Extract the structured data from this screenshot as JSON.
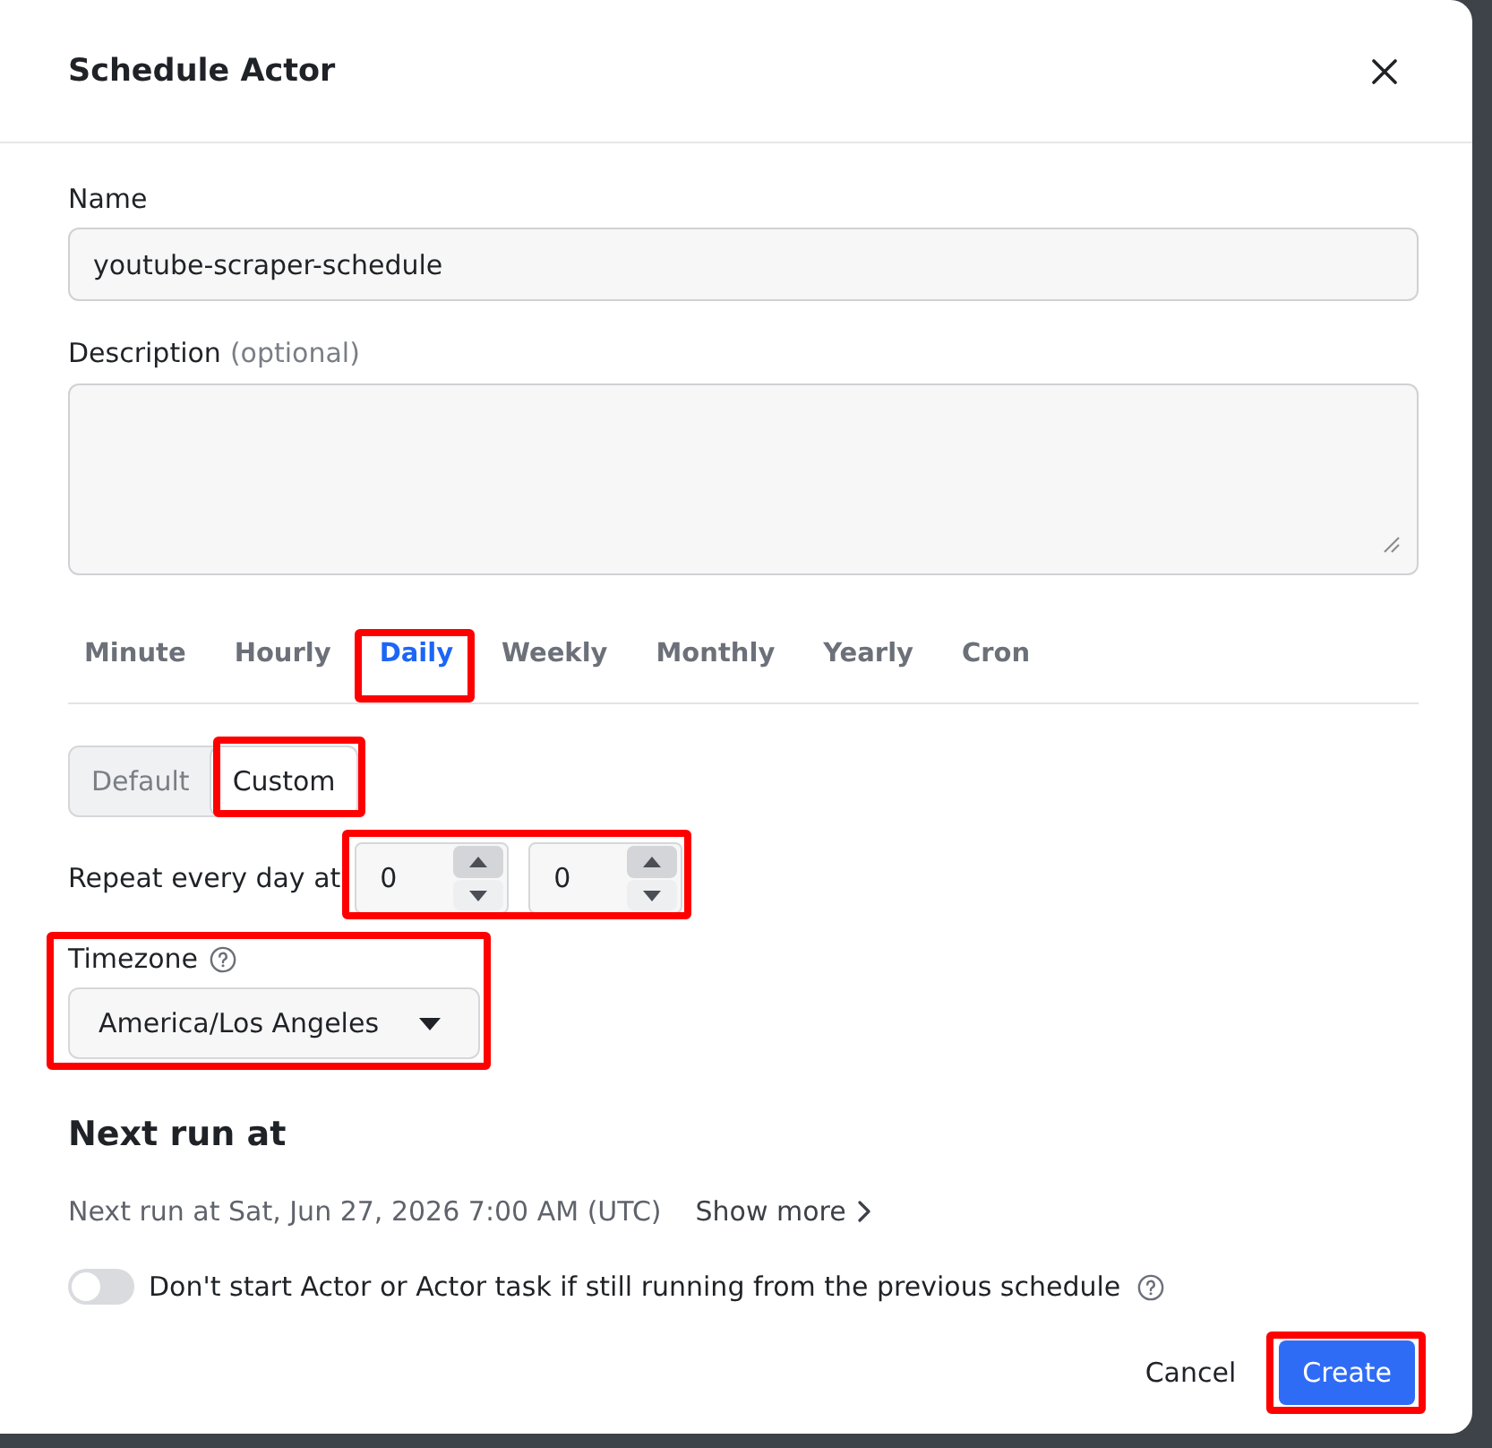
{
  "dialog": {
    "title": "Schedule Actor"
  },
  "name_field": {
    "label": "Name",
    "value": "youtube-scraper-schedule"
  },
  "description_field": {
    "label": "Description",
    "hint": "(optional)"
  },
  "schedule": {
    "tabs": [
      {
        "label": "Minute",
        "selected": false,
        "highlighted": false
      },
      {
        "label": "Hourly",
        "selected": false,
        "highlighted": false
      },
      {
        "label": "Daily",
        "selected": true,
        "highlighted": true
      },
      {
        "label": "Weekly",
        "selected": false,
        "highlighted": false
      },
      {
        "label": "Monthly",
        "selected": false,
        "highlighted": false
      },
      {
        "label": "Yearly",
        "selected": false,
        "highlighted": false
      },
      {
        "label": "Cron",
        "selected": false,
        "highlighted": false
      }
    ],
    "modes": [
      {
        "label": "Default",
        "selected": false,
        "highlighted": false
      },
      {
        "label": "Custom",
        "selected": true,
        "highlighted": true
      }
    ],
    "repeat": {
      "label": "Repeat every day at",
      "highlighted": true,
      "fields": [
        {
          "value": "0"
        },
        {
          "value": "0"
        }
      ]
    },
    "timezone": {
      "label": "Timezone",
      "value": "America/Los Angeles",
      "highlighted": true
    }
  },
  "next_run": {
    "heading": "Next run at",
    "text": "Next run at Sat, Jun 27, 2026 7:00 AM (UTC)",
    "link": "Show more"
  },
  "option": {
    "label": "Don't start Actor or Actor task if still running from the previous schedule",
    "on": false
  },
  "buttons": [
    {
      "label": "Cancel",
      "kind": "cancel",
      "highlighted": false
    },
    {
      "label": "Create",
      "kind": "submit",
      "highlighted": true
    }
  ]
}
